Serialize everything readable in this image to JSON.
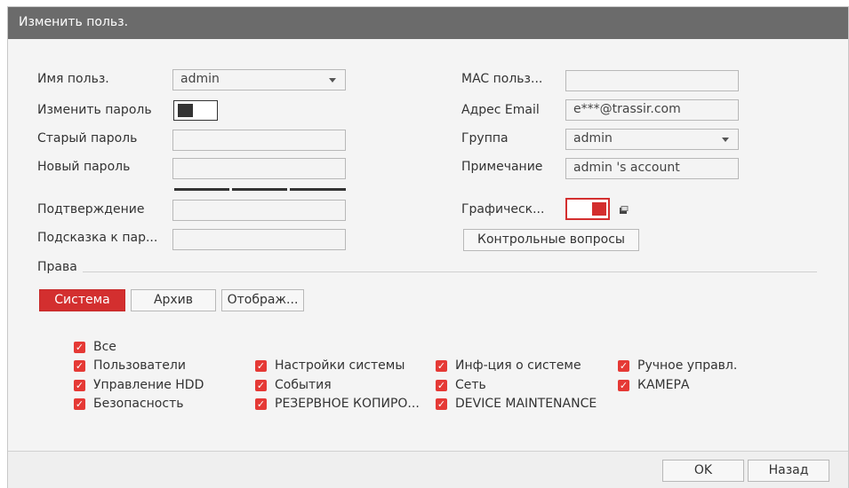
{
  "dialog": {
    "title": "Изменить польз."
  },
  "left": {
    "username_label": "Имя польз.",
    "username_value": "admin",
    "change_password_label": "Изменить пароль",
    "old_password_label": "Старый пароль",
    "old_password_value": "",
    "new_password_label": "Новый пароль",
    "new_password_value": "",
    "confirm_label": "Подтверждение",
    "confirm_value": "",
    "hint_label": "Подсказка к пар...",
    "hint_value": ""
  },
  "right": {
    "mac_label": "MAC польз...",
    "mac_value": "",
    "email_label": "Адрес Email",
    "email_value": "e***@trassir.com",
    "group_label": "Группа",
    "group_value": "admin",
    "note_label": "Примечание",
    "note_value": "admin 's account",
    "pattern_label": "Графическ...",
    "security_questions_button": "Контрольные вопросы"
  },
  "rights": {
    "section_label": "Права",
    "tabs": [
      {
        "label": "Система",
        "active": true
      },
      {
        "label": "Архив",
        "active": false
      },
      {
        "label": "Отображ...",
        "active": false
      }
    ],
    "all_label": "Все",
    "columns": [
      [
        "Пользователи",
        "Управление HDD",
        "Безопасность"
      ],
      [
        "Настройки системы",
        "События",
        "РЕЗЕРВНОЕ КОПИРО..."
      ],
      [
        "Инф-ция о системе",
        "Сеть",
        "DEVICE MAINTENANCE"
      ],
      [
        "Ручное управл.",
        "КАМЕРА"
      ]
    ]
  },
  "footer": {
    "ok": "OK",
    "back": "Назад"
  },
  "colors": {
    "accent": "#d32f2f",
    "titlebar": "#6b6b6b",
    "checkbox": "#e53935"
  },
  "icons": {
    "dropdown": "chevron-down-icon",
    "checkbox": "checkmark-icon",
    "pattern_edit": "edit-icon"
  }
}
